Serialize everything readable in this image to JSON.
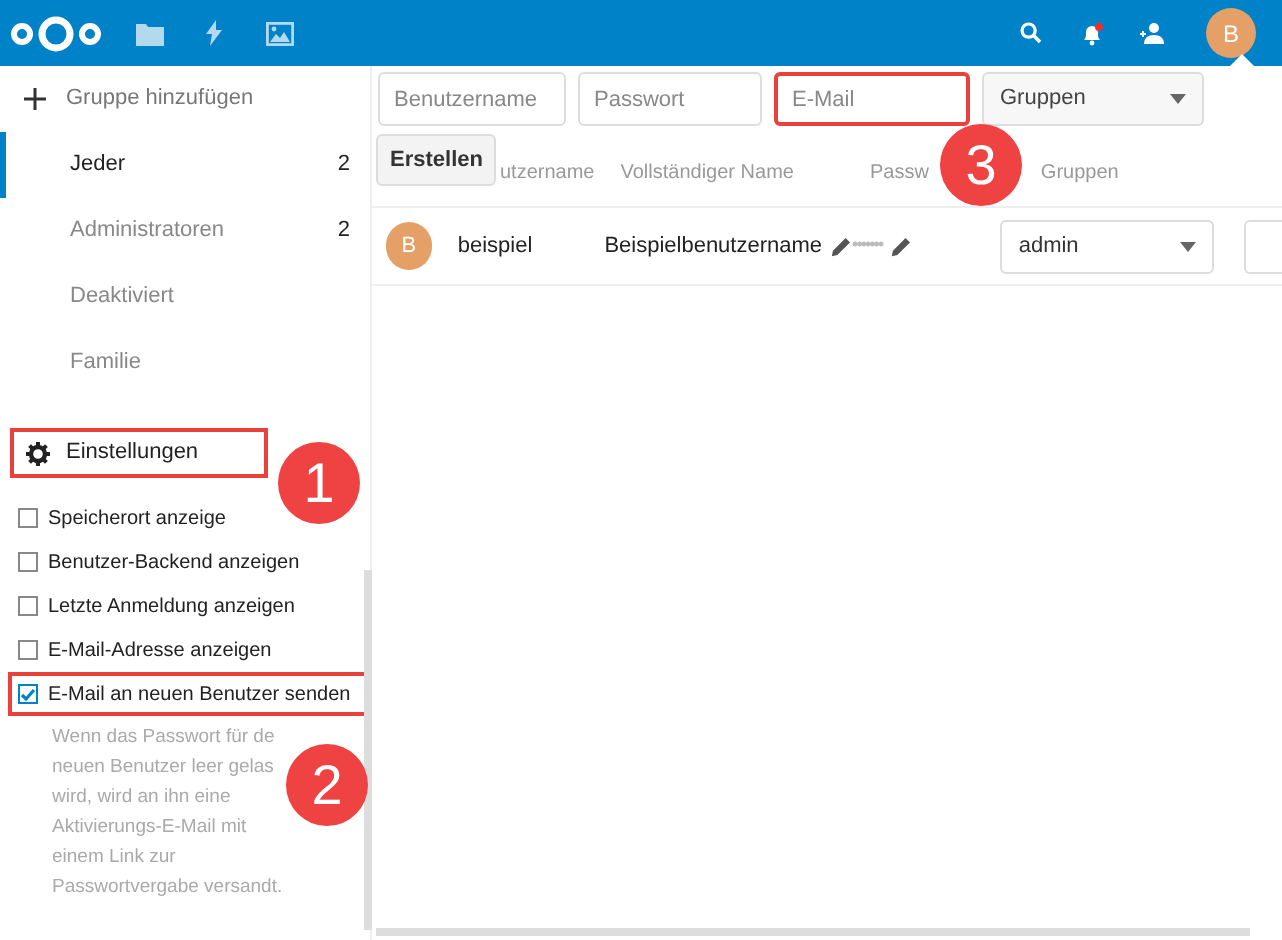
{
  "header": {
    "avatar": "B",
    "notification_dot": true
  },
  "sidebar": {
    "add_group": "Gruppe hinzufügen",
    "groups": [
      {
        "label": "Jeder",
        "count": "2",
        "selected": true
      },
      {
        "label": "Administratoren",
        "count": "2",
        "selected": false
      },
      {
        "label": "Deaktiviert",
        "selected": false
      },
      {
        "label": "Familie",
        "selected": false
      }
    ],
    "settings": {
      "label": "Einstellungen",
      "highlighted": true
    },
    "options": [
      {
        "label": "Speicherort anzeige",
        "checked": false,
        "highlighted": false
      },
      {
        "label": "Benutzer-Backend anzeigen",
        "checked": false,
        "highlighted": false
      },
      {
        "label": "Letzte Anmeldung anzeigen",
        "checked": false,
        "highlighted": false
      },
      {
        "label": "E-Mail-Adresse anzeigen",
        "checked": false,
        "highlighted": false
      },
      {
        "label": "E-Mail an neuen Benutzer senden",
        "checked": true,
        "highlighted": true
      }
    ],
    "hint": "Wenn das Passwort für de neuen Benutzer leer gelas wird, wird an ihn eine Aktivierungs-E-Mail mit einem Link zur Passwortvergabe versandt."
  },
  "new_user": {
    "fields": [
      {
        "placeholder": "Benutzername",
        "highlighted": false
      },
      {
        "placeholder": "Passwort",
        "highlighted": false
      },
      {
        "placeholder": "E-Mail",
        "highlighted": true
      }
    ],
    "groups_select": "Gruppen",
    "create_button": "Erstellen"
  },
  "table": {
    "columns": [
      "utzername",
      "Vollständiger Name",
      "Passw",
      "Gruppen"
    ],
    "rows": [
      {
        "avatar": "B",
        "username": "beispiel",
        "full_name": "Beispielbenutzername",
        "password": "•••••••",
        "group": "admin"
      }
    ]
  },
  "callouts": [
    "1",
    "2",
    "3"
  ]
}
